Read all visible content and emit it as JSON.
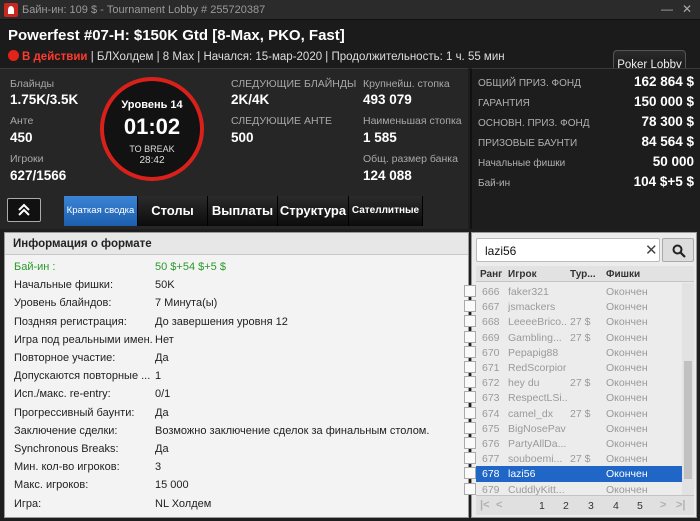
{
  "window": {
    "title": "Байн-ин: 109 $ - Tournament Lobby # 255720387",
    "controls": [
      "—",
      "✕"
    ]
  },
  "header": {
    "tournament_name": "Powerfest #07-H: $150K Gtd [8-Max, PKO, Fast]",
    "status": "В действии",
    "details": "| БЛХолдем | 8 Max | Начался: 15-мар-2020 | Продолжительность: 1 ч. 55 мин",
    "lobby_button": "Poker Lobby"
  },
  "stats": {
    "blinds_label": "Блайнды",
    "blinds_value": "1.75K/3.5K",
    "ante_label": "Анте",
    "ante_value": "450",
    "players_label": "Игроки",
    "players_value": "627/1566",
    "level_label": "Уровень 14",
    "clock": "01:02",
    "to_break_label": "TO BREAK",
    "to_break_value": "28:42",
    "next_blinds_label": "СЛЕДУЮЩИЕ БЛАЙНДЫ",
    "next_blinds_value": "2K/4K",
    "next_ante_label": "СЛЕДУЮЩИЕ АНТЕ",
    "next_ante_value": "500",
    "largest_stack_label": "Крупнейш. стопка",
    "largest_stack_value": "493 079",
    "smallest_stack_label": "Наименьшая стопка",
    "smallest_stack_value": "1 585",
    "avg_stack_label": "Общ. размер банка",
    "avg_stack_value": "124 088"
  },
  "prize": {
    "rows": [
      {
        "label": "ОБЩИЙ ПРИЗ. ФОНД",
        "value": "162 864 $"
      },
      {
        "label": "ГАРАНТИЯ",
        "value": "150 000 $"
      },
      {
        "label": "ОСНОВН. ПРИЗ. ФОНД",
        "value": "78 300 $"
      },
      {
        "label": "ПРИЗОВЫЕ БАУНТИ",
        "value": "84 564 $"
      },
      {
        "label": "Начальные фишки",
        "value": "50 000"
      },
      {
        "label": "Бай-ин",
        "value": "104 $+5 $"
      }
    ]
  },
  "tabs": [
    {
      "label": "Краткая сводка",
      "active": true
    },
    {
      "label": "Столы"
    },
    {
      "label": "Выплаты"
    },
    {
      "label": "Структура"
    },
    {
      "label": "Сателлитные"
    }
  ],
  "collapse_icon": "chevron-up-double",
  "info": {
    "title": "Информация о формате",
    "rows": [
      {
        "k": "Бай-ин :",
        "v": "50 $+54 $+5 $"
      },
      {
        "k": "Начальные фишки:",
        "v": "50K"
      },
      {
        "k": "Уровень блайндов:",
        "v": "7 Минута(ы)"
      },
      {
        "k": "Поздняя регистрация:",
        "v": "До завершения уровня 12"
      },
      {
        "k": "Игра под реальными имен...",
        "v": "Нет"
      },
      {
        "k": "Повторное участие:",
        "v": "Да"
      },
      {
        "k": "Допускаются повторные ...",
        "v": "1"
      },
      {
        "k": "Исп./макс. re-entry:",
        "v": "0/1"
      },
      {
        "k": "Прогрессивный баунти:",
        "v": "Да"
      },
      {
        "k": "Заключение сделки:",
        "v": "Возможно заключение сделок за финальным столом."
      },
      {
        "k": "Synchronous Breaks:",
        "v": "Да"
      },
      {
        "k": "Мин. кол-во игроков:",
        "v": "3"
      },
      {
        "k": "Макс. игроков:",
        "v": "15 000"
      },
      {
        "k": "Игра:",
        "v": "NL Холдем"
      }
    ]
  },
  "players": {
    "search_value": "lazi56",
    "columns": [
      "Ранг",
      "Игрок",
      "Тур...",
      "Фишки"
    ],
    "rows": [
      {
        "rank": "666",
        "name": "faker321",
        "tour": "",
        "chips": "Окончен"
      },
      {
        "rank": "667",
        "name": "jsmackers",
        "tour": "",
        "chips": "Окончен"
      },
      {
        "rank": "668",
        "name": "LeeeeBrico...",
        "tour": "27 $",
        "chips": "Окончен"
      },
      {
        "rank": "669",
        "name": "Gambling...",
        "tour": "27 $",
        "chips": "Окончен"
      },
      {
        "rank": "670",
        "name": "Pepapig88",
        "tour": "",
        "chips": "Окончен"
      },
      {
        "rank": "671",
        "name": "RedScorpior",
        "tour": "",
        "chips": "Окончен"
      },
      {
        "rank": "672",
        "name": "hey du",
        "tour": "27 $",
        "chips": "Окончен"
      },
      {
        "rank": "673",
        "name": "RespectLSi...",
        "tour": "",
        "chips": "Окончен"
      },
      {
        "rank": "674",
        "name": "camel_dx",
        "tour": "27 $",
        "chips": "Окончен"
      },
      {
        "rank": "675",
        "name": "BigNosePav",
        "tour": "",
        "chips": "Окончен"
      },
      {
        "rank": "676",
        "name": "PartyAllDa...",
        "tour": "",
        "chips": "Окончен"
      },
      {
        "rank": "677",
        "name": "souboemi...",
        "tour": "27 $",
        "chips": "Окончен"
      },
      {
        "rank": "678",
        "name": "lazi56",
        "tour": "",
        "chips": "Окончен",
        "selected": true
      },
      {
        "rank": "679",
        "name": "CuddlyKitt...",
        "tour": "",
        "chips": "Окончен"
      }
    ],
    "pages": [
      "1",
      "2",
      "3",
      "4",
      "5"
    ],
    "nav": {
      "first": "|<",
      "prev": "<",
      "next": ">",
      "last": ">|"
    }
  },
  "colors": {
    "accent": "#1f66c6",
    "status_red": "#e2231a",
    "buyin_green": "#2a9a2a"
  }
}
